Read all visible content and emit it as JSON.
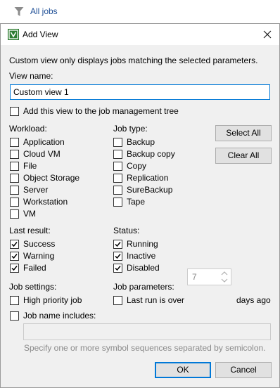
{
  "topbar": {
    "label": "All jobs"
  },
  "dialog": {
    "title": "Add View",
    "description": "Custom view only displays jobs matching the selected parameters.",
    "view_name_label": "View name:",
    "view_name_value": "Custom view 1",
    "add_to_tree_label": "Add this view to the job management tree",
    "workload": {
      "label": "Workload:",
      "items": [
        "Application",
        "Cloud VM",
        "File",
        "Object Storage",
        "Server",
        "Workstation",
        "VM"
      ]
    },
    "job_type": {
      "label": "Job type:",
      "items": [
        "Backup",
        "Backup copy",
        "Copy",
        "Replication",
        "SureBackup",
        "Tape"
      ]
    },
    "select_all": "Select All",
    "clear_all": "Clear All",
    "last_result": {
      "label": "Last result:",
      "items": [
        "Success",
        "Warning",
        "Failed"
      ]
    },
    "status": {
      "label": "Status:",
      "items": [
        "Running",
        "Inactive",
        "Disabled"
      ]
    },
    "job_settings": {
      "label": "Job settings:",
      "high_priority": "High priority job"
    },
    "job_parameters": {
      "label": "Job parameters:",
      "last_run_label": "Last run is over",
      "last_run_value": "7",
      "days_ago": "days ago"
    },
    "job_name_includes": {
      "label": "Job name includes:",
      "value": "",
      "hint": "Specify one or more symbol sequences separated by semicolon."
    },
    "ok": "OK",
    "cancel": "Cancel"
  }
}
